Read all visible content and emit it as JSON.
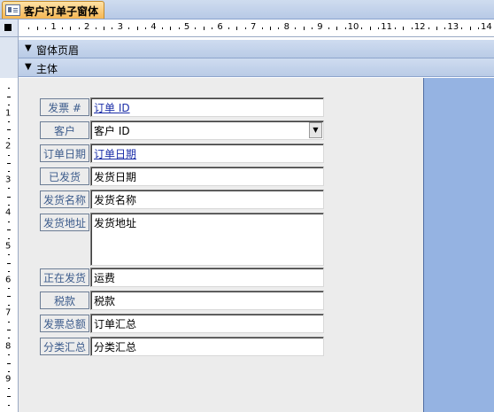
{
  "tab": {
    "title": "客户订单子窗体"
  },
  "ruler": {
    "h_numbers": [
      "1",
      "2",
      "3",
      "4",
      "5",
      "6",
      "7",
      "8",
      "9",
      "10",
      "11",
      "12",
      "13",
      "14"
    ],
    "v_numbers": [
      "1",
      "2",
      "3",
      "4",
      "5",
      "6",
      "7",
      "8",
      "9"
    ]
  },
  "sections": {
    "header_label": "窗体页眉",
    "detail_label": "主体"
  },
  "form": {
    "rows": [
      {
        "label": "发票 #",
        "value": "订单 ID",
        "style": "link"
      },
      {
        "label": "客户",
        "value": "客户 ID",
        "style": "combo"
      },
      {
        "label": "订单日期",
        "value": "订单日期",
        "style": "link"
      },
      {
        "label": "已发货",
        "value": "发货日期",
        "style": "text"
      },
      {
        "label": "发货名称",
        "value": "发货名称",
        "style": "text"
      },
      {
        "label": "发货地址",
        "value": "发货地址",
        "style": "multi"
      },
      {
        "label": "正在发货",
        "value": "运费",
        "style": "text"
      },
      {
        "label": "税款",
        "value": "税款",
        "style": "text"
      },
      {
        "label": "发票总额",
        "value": "订单汇总",
        "style": "text"
      },
      {
        "label": "分类汇总",
        "value": "分类汇总",
        "style": "text"
      }
    ]
  }
}
